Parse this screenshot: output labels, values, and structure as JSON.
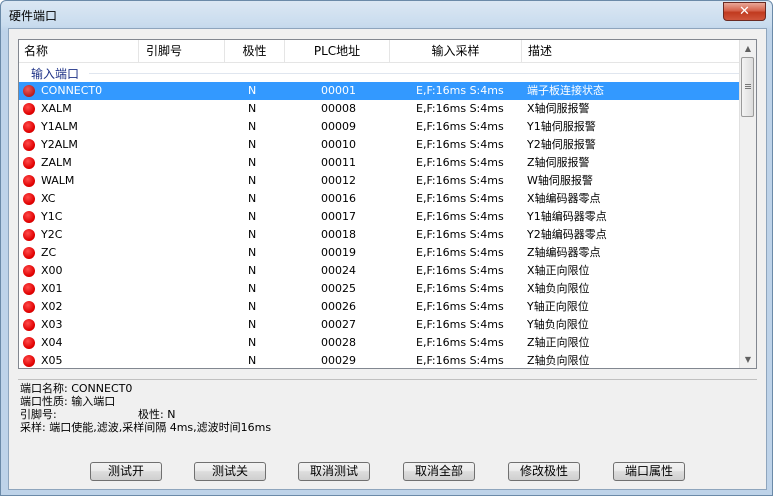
{
  "window": {
    "title": "硬件端口",
    "close_glyph": "✕"
  },
  "columns": [
    "名称",
    "引脚号",
    "极性",
    "PLC地址",
    "输入采样",
    "描述"
  ],
  "group": {
    "label": "输入端口"
  },
  "rows": [
    {
      "name": "CONNECT0",
      "pin": "",
      "polarity": "N",
      "plc": "00001",
      "sample": "E,F:16ms S:4ms",
      "desc": "端子板连接状态",
      "selected": true
    },
    {
      "name": "XALM",
      "pin": "",
      "polarity": "N",
      "plc": "00008",
      "sample": "E,F:16ms S:4ms",
      "desc": "X轴伺服报警"
    },
    {
      "name": "Y1ALM",
      "pin": "",
      "polarity": "N",
      "plc": "00009",
      "sample": "E,F:16ms S:4ms",
      "desc": "Y1轴伺服报警"
    },
    {
      "name": "Y2ALM",
      "pin": "",
      "polarity": "N",
      "plc": "00010",
      "sample": "E,F:16ms S:4ms",
      "desc": "Y2轴伺服报警"
    },
    {
      "name": "ZALM",
      "pin": "",
      "polarity": "N",
      "plc": "00011",
      "sample": "E,F:16ms S:4ms",
      "desc": "Z轴伺服报警"
    },
    {
      "name": "WALM",
      "pin": "",
      "polarity": "N",
      "plc": "00012",
      "sample": "E,F:16ms S:4ms",
      "desc": "W轴伺服报警"
    },
    {
      "name": "XC",
      "pin": "",
      "polarity": "N",
      "plc": "00016",
      "sample": "E,F:16ms S:4ms",
      "desc": "X轴编码器零点"
    },
    {
      "name": "Y1C",
      "pin": "",
      "polarity": "N",
      "plc": "00017",
      "sample": "E,F:16ms S:4ms",
      "desc": "Y1轴编码器零点"
    },
    {
      "name": "Y2C",
      "pin": "",
      "polarity": "N",
      "plc": "00018",
      "sample": "E,F:16ms S:4ms",
      "desc": "Y2轴编码器零点"
    },
    {
      "name": "ZC",
      "pin": "",
      "polarity": "N",
      "plc": "00019",
      "sample": "E,F:16ms S:4ms",
      "desc": "Z轴编码器零点"
    },
    {
      "name": "X00",
      "pin": "",
      "polarity": "N",
      "plc": "00024",
      "sample": "E,F:16ms S:4ms",
      "desc": "X轴正向限位"
    },
    {
      "name": "X01",
      "pin": "",
      "polarity": "N",
      "plc": "00025",
      "sample": "E,F:16ms S:4ms",
      "desc": "X轴负向限位"
    },
    {
      "name": "X02",
      "pin": "",
      "polarity": "N",
      "plc": "00026",
      "sample": "E,F:16ms S:4ms",
      "desc": "Y轴正向限位"
    },
    {
      "name": "X03",
      "pin": "",
      "polarity": "N",
      "plc": "00027",
      "sample": "E,F:16ms S:4ms",
      "desc": "Y轴负向限位"
    },
    {
      "name": "X04",
      "pin": "",
      "polarity": "N",
      "plc": "00028",
      "sample": "E,F:16ms S:4ms",
      "desc": "Z轴正向限位"
    },
    {
      "name": "X05",
      "pin": "",
      "polarity": "N",
      "plc": "00029",
      "sample": "E,F:16ms S:4ms",
      "desc": "Z轴负向限位"
    }
  ],
  "info": {
    "name_line": "端口名称: CONNECT0",
    "type_line": "端口性质: 输入端口",
    "pin_label": "引脚号:",
    "polarity_line": "极性: N",
    "sample_line": "采样: 端口使能,滤波,采样间隔 4ms,滤波时间16ms"
  },
  "buttons": [
    "测试开",
    "测试关",
    "取消测试",
    "取消全部",
    "修改极性",
    "端口属性"
  ],
  "colors": {
    "selection": "#3399ff",
    "status_dot": "#e00000",
    "group_label": "#1e3287"
  }
}
